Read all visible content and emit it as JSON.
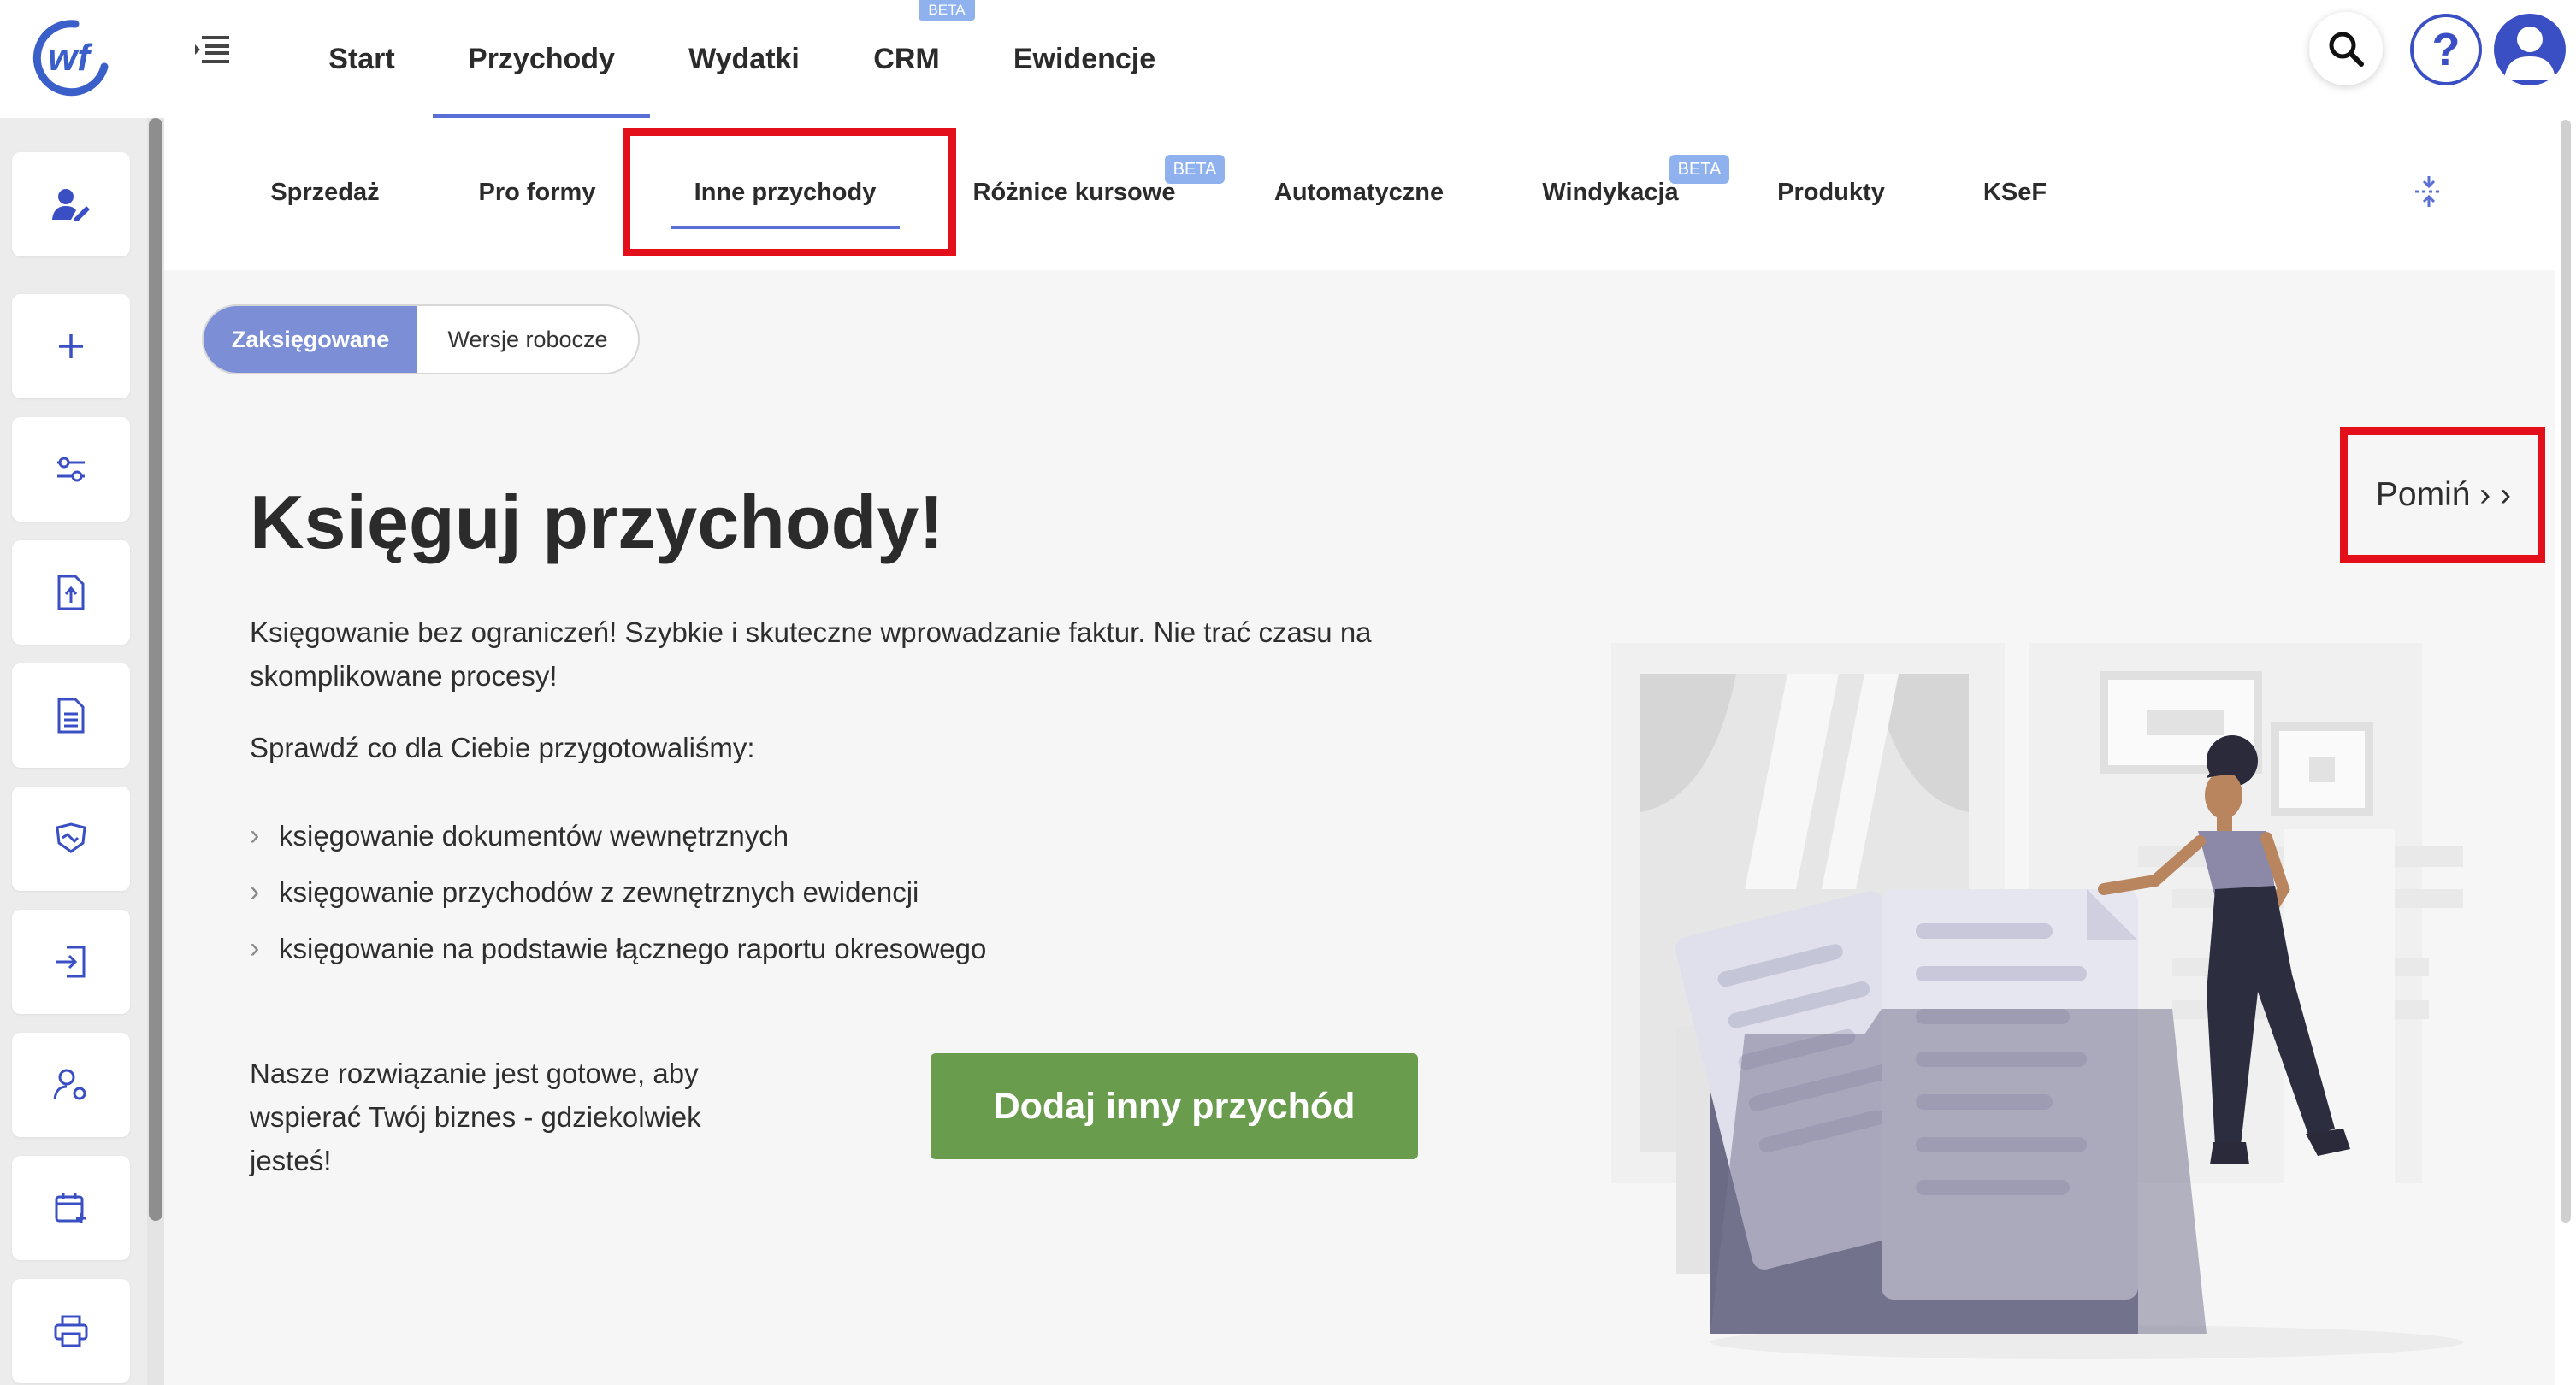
{
  "topnav": {
    "items": [
      {
        "label": "Start"
      },
      {
        "label": "Przychody"
      },
      {
        "label": "Wydatki"
      },
      {
        "label": "CRM",
        "badge": "BETA"
      },
      {
        "label": "Ewidencje"
      }
    ],
    "active": "Przychody"
  },
  "subtabs": {
    "items": [
      {
        "label": "Sprzedaż"
      },
      {
        "label": "Pro formy"
      },
      {
        "label": "Inne przychody"
      },
      {
        "label": "Różnice kursowe",
        "badge": "BETA"
      },
      {
        "label": "Automatyczne"
      },
      {
        "label": "Windykacja",
        "badge": "BETA"
      },
      {
        "label": "Produkty"
      },
      {
        "label": "KSeF"
      }
    ],
    "active": "Inne przychody"
  },
  "segment": {
    "options": [
      "Zaksięgowane",
      "Wersje robocze"
    ],
    "selected": "Zaksięgowane"
  },
  "content": {
    "headline": "Księguj przychody!",
    "intro": "Księgowanie bez ograniczeń! Szybkie i skuteczne wprowadzanie faktur. Nie trać czasu na skomplikowane procesy!",
    "check_title": "Sprawdź co dla Ciebie przygotowaliśmy:",
    "features": [
      "księgowanie dokumentów wewnętrznych",
      "księgowanie przychodów z zewnętrznych ewidencji",
      "księgowanie na podstawie łącznego raportu okresowego"
    ],
    "bottom_text": "Nasze rozwiązanie jest gotowe, aby wspierać Twój biznes - gdziekolwiek jesteś!",
    "cta_label": "Dodaj inny przychód",
    "skip_label": "Pomiń › ›"
  },
  "sidebar": {
    "icons": [
      "user-edit-icon",
      "plus-icon",
      "sliders-icon",
      "file-upload-icon",
      "document-icon",
      "handshake-icon",
      "import-icon",
      "user-settings-icon",
      "calendar-add-icon",
      "printer-icon"
    ]
  },
  "colors": {
    "accent": "#5a6fd6",
    "segment_active": "#7b8ed6",
    "cta": "#6a9c4e",
    "highlight": "#e3101b",
    "beta": "#8fb2ee",
    "brand": "#3b4fc4"
  }
}
